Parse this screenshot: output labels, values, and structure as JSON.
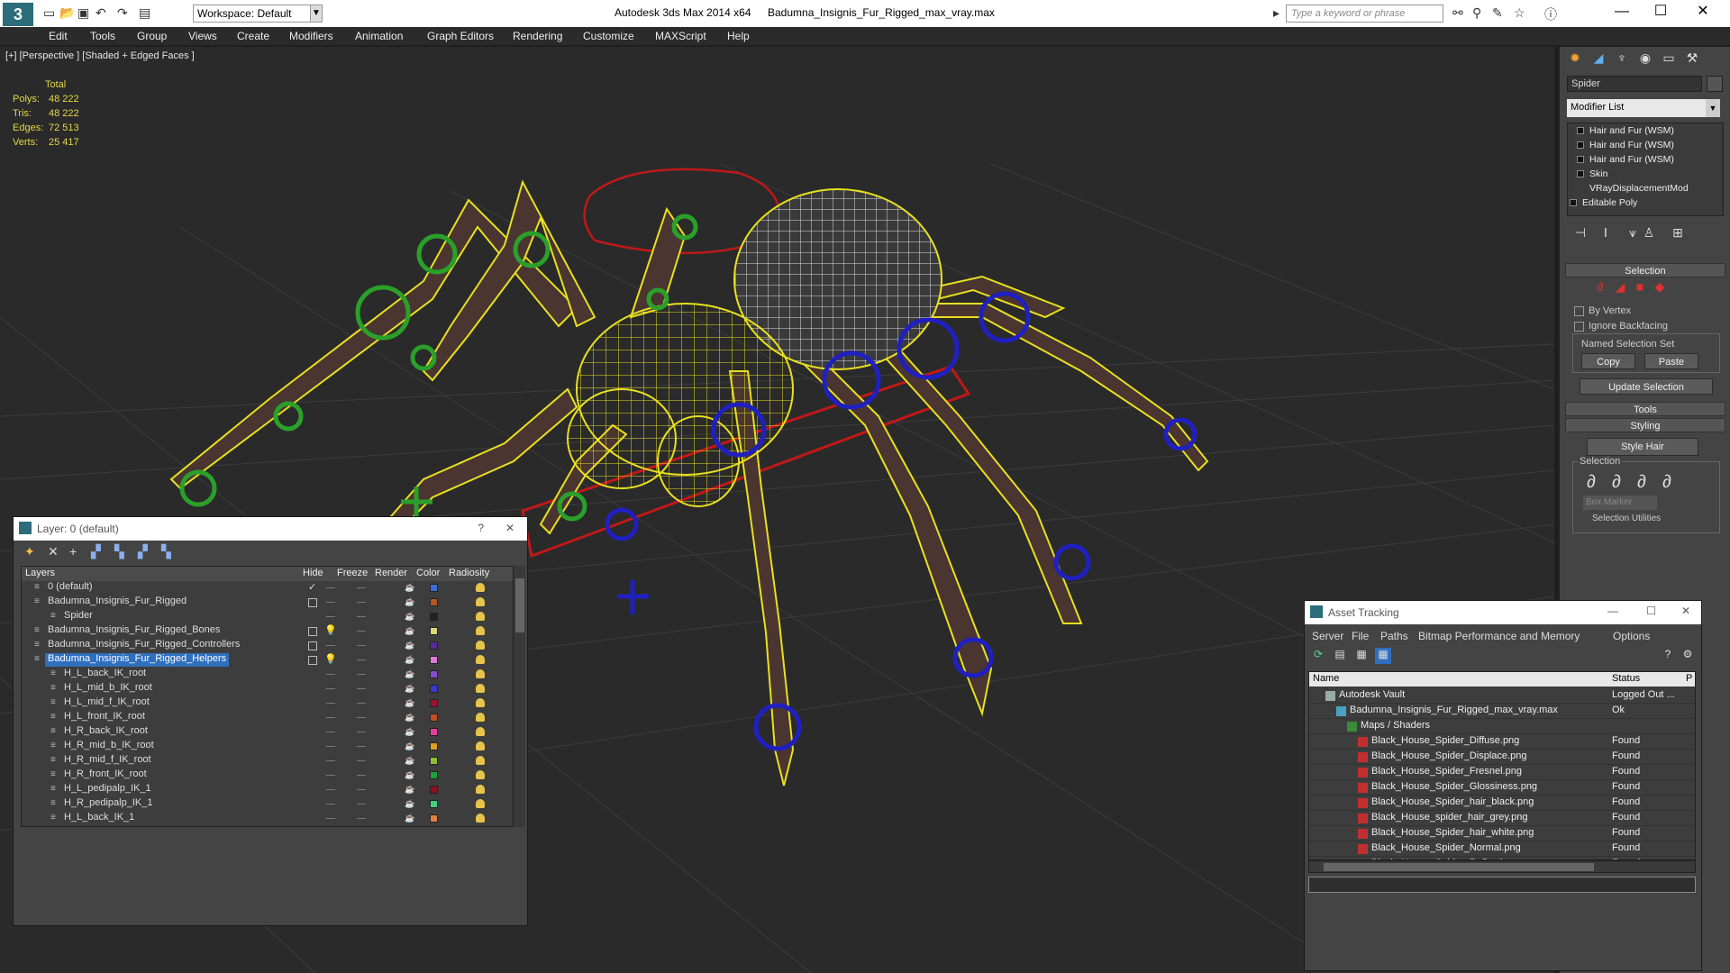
{
  "titlebar": {
    "logo": "3",
    "workspace": "Workspace: Default",
    "app_title": "Autodesk 3ds Max  2014 x64",
    "file_name": "Badumna_Insignis_Fur_Rigged_max_vray.max",
    "search_placeholder": "Type a keyword or phrase",
    "minimize": "—",
    "maximize": "☐",
    "close": "✕"
  },
  "menu": [
    "Edit",
    "Tools",
    "Group",
    "Views",
    "Create",
    "Modifiers",
    "Animation",
    "Graph Editors",
    "Rendering",
    "Customize",
    "MAXScript",
    "Help"
  ],
  "viewport": {
    "label": "[+] [Perspective ] [Shaded + Edged Faces ]",
    "stats": {
      "header": "Total",
      "polys_label": "Polys:",
      "polys": "48 222",
      "tris_label": "Tris:",
      "tris": "48 222",
      "edges_label": "Edges:",
      "edges": "72 513",
      "verts_label": "Verts:",
      "verts": "25 417"
    }
  },
  "command_panel": {
    "object_name": "Spider",
    "modifier_list": "Modifier List",
    "stack": [
      "Hair and Fur (WSM)",
      "Hair and Fur (WSM)",
      "Hair and Fur (WSM)",
      "Skin",
      "VRayDisplacementMod",
      "Editable Poly"
    ],
    "selection_header": "Selection",
    "by_vertex": "By Vertex",
    "ignore_backfacing": "Ignore Backfacing",
    "named_selection_set": "Named Selection Set",
    "copy": "Copy",
    "paste": "Paste",
    "update_selection": "Update Selection",
    "tools_header": "Tools",
    "styling_header": "Styling",
    "style_hair": "Style Hair",
    "selection_sub": "Selection",
    "box_marker": "Box Marker",
    "selection_utilities": "Selection Utilities"
  },
  "layer_window": {
    "title": "Layer: 0 (default)",
    "help": "?",
    "close": "✕",
    "columns": [
      "Layers",
      "Hide",
      "Freeze",
      "Render",
      "Color",
      "Radiosity"
    ],
    "rows": [
      {
        "name": "0 (default)",
        "indent": 1,
        "color": "#3a6fd8",
        "check": true
      },
      {
        "name": "Badumna_Insignis_Fur_Rigged",
        "indent": 1,
        "color": "#b8571f",
        "box": true
      },
      {
        "name": "Spider",
        "indent": 2,
        "color": "#222222"
      },
      {
        "name": "Badumna_Insignis_Fur_Rigged_Bones",
        "indent": 1,
        "color": "#d8d87a",
        "box": true,
        "bulb": true
      },
      {
        "name": "Badumna_Insignis_Fur_Rigged_Controllers",
        "indent": 1,
        "color": "#5a2aa0",
        "box": true
      },
      {
        "name": "Badumna_Insignis_Fur_Rigged_Helpers",
        "indent": 1,
        "color": "#e07ad8",
        "box": true,
        "bulb": true,
        "selected": true
      },
      {
        "name": "H_L_back_IK_root",
        "indent": 2,
        "color": "#8a4ad0"
      },
      {
        "name": "H_L_mid_b_IK_root",
        "indent": 2,
        "color": "#3a3ad0"
      },
      {
        "name": "H_L_mid_f_IK_root",
        "indent": 2,
        "color": "#a01030"
      },
      {
        "name": "H_L_front_IK_root",
        "indent": 2,
        "color": "#c05020"
      },
      {
        "name": "H_R_back_IK_root",
        "indent": 2,
        "color": "#e040a0"
      },
      {
        "name": "H_R_mid_b_IK_root",
        "indent": 2,
        "color": "#e0a020"
      },
      {
        "name": "H_R_mid_f_IK_root",
        "indent": 2,
        "color": "#90c030"
      },
      {
        "name": "H_R_front_IK_root",
        "indent": 2,
        "color": "#20a040"
      },
      {
        "name": "H_L_pedipalp_IK_1",
        "indent": 2,
        "color": "#901020"
      },
      {
        "name": "H_R_pedipalp_IK_1",
        "indent": 2,
        "color": "#40d080"
      },
      {
        "name": "H_L_back_IK_1",
        "indent": 2,
        "color": "#e08040"
      }
    ]
  },
  "asset_window": {
    "title": "Asset Tracking",
    "menu": [
      "Server",
      "File",
      "Paths",
      "Bitmap Performance and Memory",
      "Options"
    ],
    "columns": [
      "Name",
      "Status",
      "P"
    ],
    "rows": [
      {
        "name": "Autodesk Vault",
        "status": "Logged Out ...",
        "indent": 1,
        "kind": "vault"
      },
      {
        "name": "Badumna_Insignis_Fur_Rigged_max_vray.max",
        "status": "Ok",
        "indent": 2,
        "kind": "max"
      },
      {
        "name": "Maps / Shaders",
        "status": "",
        "indent": 3,
        "kind": "maps"
      },
      {
        "name": "Black_House_Spider_Diffuse.png",
        "status": "Found",
        "indent": 4,
        "kind": "png"
      },
      {
        "name": "Black_House_Spider_Displace.png",
        "status": "Found",
        "indent": 4,
        "kind": "png"
      },
      {
        "name": "Black_House_Spider_Fresnel.png",
        "status": "Found",
        "indent": 4,
        "kind": "png"
      },
      {
        "name": "Black_House_Spider_Glossiness.png",
        "status": "Found",
        "indent": 4,
        "kind": "png"
      },
      {
        "name": "Black_House_Spider_hair_black.png",
        "status": "Found",
        "indent": 4,
        "kind": "png"
      },
      {
        "name": "Black_House_spider_hair_grey.png",
        "status": "Found",
        "indent": 4,
        "kind": "png"
      },
      {
        "name": "Black_House_Spider_hair_white.png",
        "status": "Found",
        "indent": 4,
        "kind": "png"
      },
      {
        "name": "Black_House_Spider_Normal.png",
        "status": "Found",
        "indent": 4,
        "kind": "png"
      },
      {
        "name": "Black_House_Spider_Reflection.png",
        "status": "Found",
        "indent": 4,
        "kind": "png"
      }
    ]
  },
  "colors": {
    "wire": "#e8e020",
    "green_ctrl": "#2aa02a",
    "blue_ctrl": "#2020c0",
    "red_ctrl": "#c01818",
    "selected": "#2f6fbd"
  }
}
